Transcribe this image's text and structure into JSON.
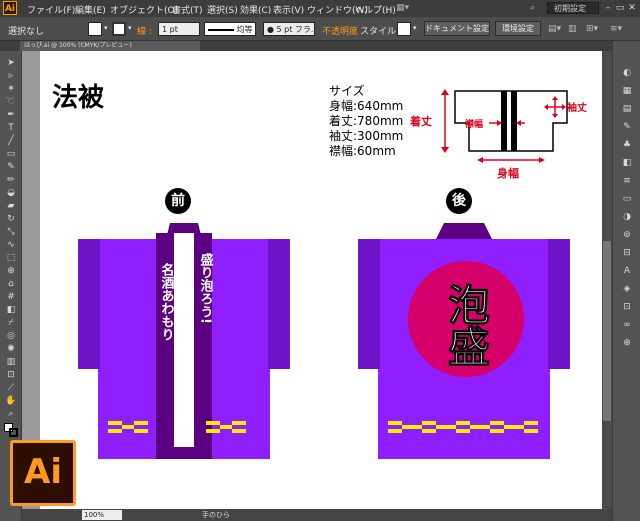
{
  "app": {
    "logo": "Ai",
    "colors": {
      "accent": "#ff9a1f",
      "purple": "#8f1fff",
      "dark_purple": "#5a0080",
      "magenta": "#d6006a",
      "yellow": "#ffee00",
      "red": "#e0001a"
    }
  },
  "menu": {
    "items": [
      "ファイル(F)",
      "編集(E)",
      "オブジェクト(O)",
      "書式(T)",
      "選択(S)",
      "効果(C)",
      "表示(V)",
      "ウィンドウ(W)",
      "ヘルプ(H)"
    ],
    "workspace": "初期設定"
  },
  "control": {
    "selection": "選択なし",
    "stroke_label": "線 :",
    "stroke_weight": "1 pt",
    "stroke_style": "均等",
    "brush": "5 pt フラ...",
    "opacity_label": "不透明度",
    "style_label": "スタイル :",
    "doc_settings": "ドキュメント設定",
    "env_settings": "環境設定"
  },
  "tab": {
    "label": "はっぴ.ai @ 100% (CMYK/プレビュー)"
  },
  "status": {
    "zoom": "100%",
    "tool": "手のひら"
  },
  "artboard": {
    "title": "法被",
    "specs": [
      "サイズ",
      "身幅:640mm",
      "着丈:780mm",
      "袖丈:300mm",
      "襟幅:60mm"
    ],
    "diagram_labels": {
      "length": "着丈",
      "collar": "襟幅",
      "sleeve": "袖丈",
      "width": "身幅"
    },
    "front_label": "前",
    "back_label": "後",
    "front_collar_text": "盛り泡ろう!",
    "front_inner_text": "名酒あわもり",
    "back_text": "泡盛"
  }
}
